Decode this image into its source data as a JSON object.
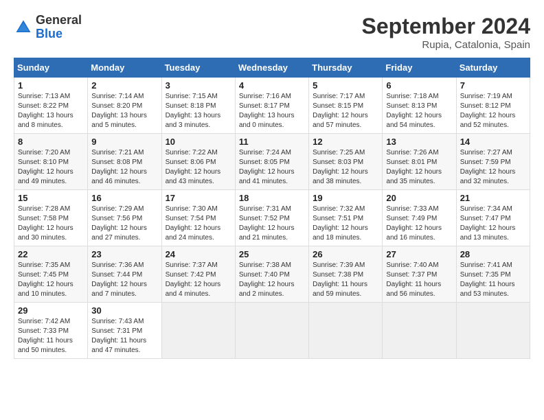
{
  "header": {
    "logo_general": "General",
    "logo_blue": "Blue",
    "month_title": "September 2024",
    "location": "Rupia, Catalonia, Spain"
  },
  "weekdays": [
    "Sunday",
    "Monday",
    "Tuesday",
    "Wednesday",
    "Thursday",
    "Friday",
    "Saturday"
  ],
  "weeks": [
    [
      {
        "day": "1",
        "info": "Sunrise: 7:13 AM\nSunset: 8:22 PM\nDaylight: 13 hours\nand 8 minutes."
      },
      {
        "day": "2",
        "info": "Sunrise: 7:14 AM\nSunset: 8:20 PM\nDaylight: 13 hours\nand 5 minutes."
      },
      {
        "day": "3",
        "info": "Sunrise: 7:15 AM\nSunset: 8:18 PM\nDaylight: 13 hours\nand 3 minutes."
      },
      {
        "day": "4",
        "info": "Sunrise: 7:16 AM\nSunset: 8:17 PM\nDaylight: 13 hours\nand 0 minutes."
      },
      {
        "day": "5",
        "info": "Sunrise: 7:17 AM\nSunset: 8:15 PM\nDaylight: 12 hours\nand 57 minutes."
      },
      {
        "day": "6",
        "info": "Sunrise: 7:18 AM\nSunset: 8:13 PM\nDaylight: 12 hours\nand 54 minutes."
      },
      {
        "day": "7",
        "info": "Sunrise: 7:19 AM\nSunset: 8:12 PM\nDaylight: 12 hours\nand 52 minutes."
      }
    ],
    [
      {
        "day": "8",
        "info": "Sunrise: 7:20 AM\nSunset: 8:10 PM\nDaylight: 12 hours\nand 49 minutes."
      },
      {
        "day": "9",
        "info": "Sunrise: 7:21 AM\nSunset: 8:08 PM\nDaylight: 12 hours\nand 46 minutes."
      },
      {
        "day": "10",
        "info": "Sunrise: 7:22 AM\nSunset: 8:06 PM\nDaylight: 12 hours\nand 43 minutes."
      },
      {
        "day": "11",
        "info": "Sunrise: 7:24 AM\nSunset: 8:05 PM\nDaylight: 12 hours\nand 41 minutes."
      },
      {
        "day": "12",
        "info": "Sunrise: 7:25 AM\nSunset: 8:03 PM\nDaylight: 12 hours\nand 38 minutes."
      },
      {
        "day": "13",
        "info": "Sunrise: 7:26 AM\nSunset: 8:01 PM\nDaylight: 12 hours\nand 35 minutes."
      },
      {
        "day": "14",
        "info": "Sunrise: 7:27 AM\nSunset: 7:59 PM\nDaylight: 12 hours\nand 32 minutes."
      }
    ],
    [
      {
        "day": "15",
        "info": "Sunrise: 7:28 AM\nSunset: 7:58 PM\nDaylight: 12 hours\nand 30 minutes."
      },
      {
        "day": "16",
        "info": "Sunrise: 7:29 AM\nSunset: 7:56 PM\nDaylight: 12 hours\nand 27 minutes."
      },
      {
        "day": "17",
        "info": "Sunrise: 7:30 AM\nSunset: 7:54 PM\nDaylight: 12 hours\nand 24 minutes."
      },
      {
        "day": "18",
        "info": "Sunrise: 7:31 AM\nSunset: 7:52 PM\nDaylight: 12 hours\nand 21 minutes."
      },
      {
        "day": "19",
        "info": "Sunrise: 7:32 AM\nSunset: 7:51 PM\nDaylight: 12 hours\nand 18 minutes."
      },
      {
        "day": "20",
        "info": "Sunrise: 7:33 AM\nSunset: 7:49 PM\nDaylight: 12 hours\nand 16 minutes."
      },
      {
        "day": "21",
        "info": "Sunrise: 7:34 AM\nSunset: 7:47 PM\nDaylight: 12 hours\nand 13 minutes."
      }
    ],
    [
      {
        "day": "22",
        "info": "Sunrise: 7:35 AM\nSunset: 7:45 PM\nDaylight: 12 hours\nand 10 minutes."
      },
      {
        "day": "23",
        "info": "Sunrise: 7:36 AM\nSunset: 7:44 PM\nDaylight: 12 hours\nand 7 minutes."
      },
      {
        "day": "24",
        "info": "Sunrise: 7:37 AM\nSunset: 7:42 PM\nDaylight: 12 hours\nand 4 minutes."
      },
      {
        "day": "25",
        "info": "Sunrise: 7:38 AM\nSunset: 7:40 PM\nDaylight: 12 hours\nand 2 minutes."
      },
      {
        "day": "26",
        "info": "Sunrise: 7:39 AM\nSunset: 7:38 PM\nDaylight: 11 hours\nand 59 minutes."
      },
      {
        "day": "27",
        "info": "Sunrise: 7:40 AM\nSunset: 7:37 PM\nDaylight: 11 hours\nand 56 minutes."
      },
      {
        "day": "28",
        "info": "Sunrise: 7:41 AM\nSunset: 7:35 PM\nDaylight: 11 hours\nand 53 minutes."
      }
    ],
    [
      {
        "day": "29",
        "info": "Sunrise: 7:42 AM\nSunset: 7:33 PM\nDaylight: 11 hours\nand 50 minutes."
      },
      {
        "day": "30",
        "info": "Sunrise: 7:43 AM\nSunset: 7:31 PM\nDaylight: 11 hours\nand 47 minutes."
      },
      {
        "day": "",
        "info": ""
      },
      {
        "day": "",
        "info": ""
      },
      {
        "day": "",
        "info": ""
      },
      {
        "day": "",
        "info": ""
      },
      {
        "day": "",
        "info": ""
      }
    ]
  ]
}
